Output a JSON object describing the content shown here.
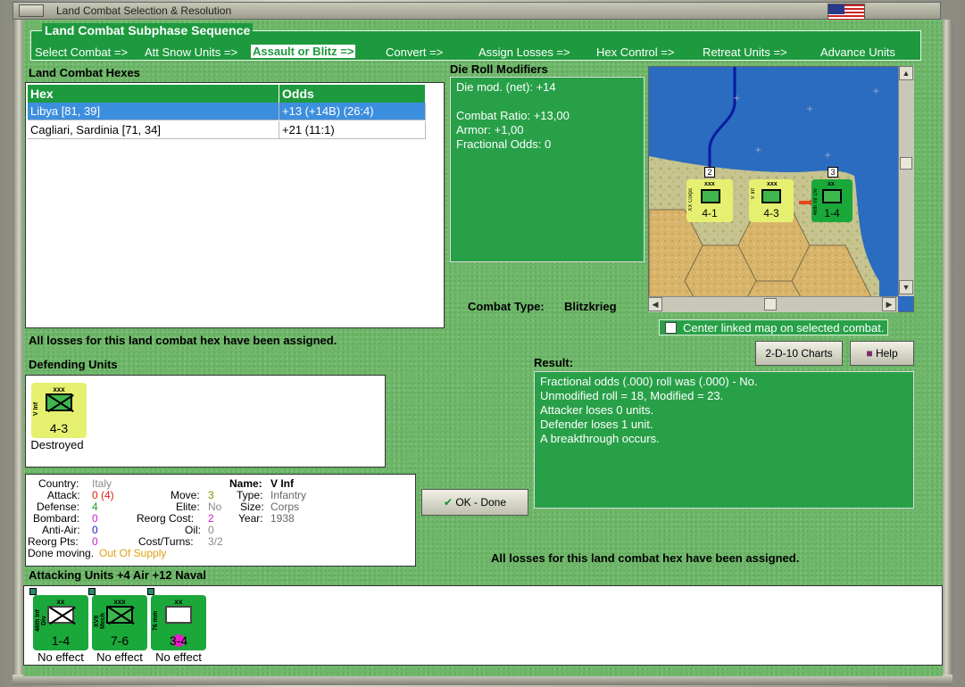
{
  "window": {
    "title": "Land Combat Selection & Resolution"
  },
  "subphase": {
    "title": "Land Combat Subphase Sequence",
    "steps": [
      "Select Combat =>",
      "Att Snow Units =>",
      "Assault or Blitz =>",
      "Convert =>",
      "Assign Losses =>",
      "Hex Control =>",
      "Retreat Units =>",
      "Advance Units"
    ],
    "active_index": 2
  },
  "hexes": {
    "title": "Land Combat Hexes",
    "headers": [
      "Hex",
      "Odds"
    ],
    "rows": [
      {
        "hex": "Libya [81, 39]",
        "odds": "+13 (+14B) (26:4)",
        "selected": true
      },
      {
        "hex": "Cagliari, Sardinia [71, 34]",
        "odds": "+21 (11:1)",
        "selected": false
      }
    ]
  },
  "modifiers": {
    "title": "Die Roll Modifiers",
    "net": "Die mod. (net): +14",
    "ratio": "Combat Ratio: +13,00",
    "armor": "Armor: +1,00",
    "fractional": "Fractional Odds: 0"
  },
  "combat_type": {
    "label": "Combat Type:",
    "value": "Blitzkrieg"
  },
  "center_map": {
    "label": "Center linked map on selected combat."
  },
  "buttons": {
    "charts": "2-D-10 Charts",
    "help": "Help",
    "ok": "OK - Done"
  },
  "losses_note": "All losses for this land combat hex have been assigned.",
  "losses_note2": "All losses for this land combat hex have been assigned.",
  "defending": {
    "title": "Defending Units",
    "units": [
      {
        "name": "V Inf",
        "size": "xxx",
        "value": "4-3",
        "result": "Destroyed",
        "color": "#e6f070"
      }
    ]
  },
  "result": {
    "title": "Result:",
    "lines": [
      "Fractional odds (.000) roll was (.000)  - No.",
      "Unmodified roll = 18, Modified = 23.",
      "Attacker loses 0 units.",
      "Defender loses 1 unit.",
      "A breakthrough occurs."
    ]
  },
  "unit_info": {
    "country_lbl": "Country:",
    "country": "Italy",
    "attack_lbl": "Attack:",
    "attack": "0",
    "attack_extra": "(4)",
    "defense_lbl": "Defense:",
    "defense": "4",
    "bombard_lbl": "Bombard:",
    "bombard": "0",
    "antiair_lbl": "Anti-Air:",
    "antiair": "0",
    "reorgpts_lbl": "Reorg Pts:",
    "reorgpts": "0",
    "move_lbl": "Move:",
    "move": "3",
    "elite_lbl": "Elite:",
    "elite": "No",
    "reorgcost_lbl": "Reorg Cost:",
    "reorgcost": "2",
    "oil_lbl": "Oil:",
    "oil": "0",
    "costturns_lbl": "Cost/Turns:",
    "costturns": "3/2",
    "name_lbl": "Name:",
    "name": "V Inf",
    "type_lbl": "Type:",
    "type": "Infantry",
    "size_lbl": "Size:",
    "size": "Corps",
    "year_lbl": "Year:",
    "year": "1938",
    "done_moving": "Done moving.",
    "supply": "Out Of Supply"
  },
  "attacking": {
    "title": "Attacking Units +4 Air +12 Naval",
    "units": [
      {
        "name": "46th Inf Div",
        "size": "xx",
        "value": "1-4",
        "result": "No effect"
      },
      {
        "name": "XVII Mech",
        "size": "xxx",
        "value": "7-6",
        "result": "No effect"
      },
      {
        "name": "76 mm",
        "size": "xx",
        "value": "3-4",
        "result": "No effect"
      }
    ]
  },
  "map": {
    "counters": [
      {
        "name": "XX Corps",
        "size": "xxx",
        "value": "4-1",
        "stack": "2"
      },
      {
        "name": "V Inf",
        "size": "xxx",
        "value": "4-3",
        "stack": ""
      },
      {
        "name": "46th Inf Div",
        "size": "xx",
        "value": "1-4",
        "stack": "3"
      }
    ]
  }
}
